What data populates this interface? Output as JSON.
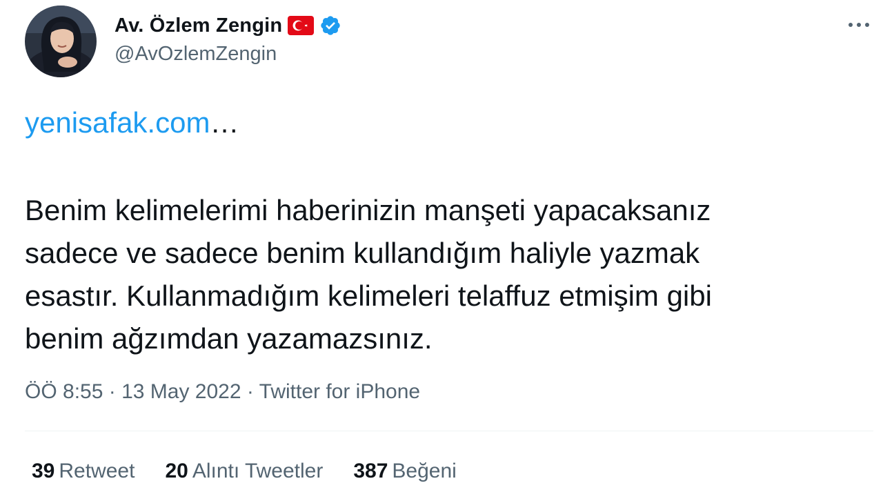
{
  "author": {
    "display_name": "Av. Özlem Zengin",
    "handle": "@AvOzlemZengin",
    "badges": [
      "turkey-flag-icon",
      "verified-icon"
    ],
    "verified_color": "#1d9bf0",
    "flag_color": "#e30a17"
  },
  "tweet": {
    "link_text": "yenisafak.com",
    "link_ellipsis": "…",
    "body_lines": [
      "Benim kelimelerimi haberinizin manşeti yapacaksanız",
      "sadece ve sadece benim kullandığım haliyle yazmak",
      "esastır. Kullanmadığım kelimeleri telaffuz etmişim gibi",
      "benim ağzımdan yazamazsınız."
    ]
  },
  "meta": {
    "time": "ÖÖ 8:55",
    "separator": " · ",
    "date": "13 May 2022",
    "source": "Twitter for iPhone"
  },
  "stats": [
    {
      "count": "39",
      "label": "Retweet"
    },
    {
      "count": "20",
      "label": "Alıntı Tweetler"
    },
    {
      "count": "387",
      "label": "Beğeni"
    }
  ],
  "colors": {
    "text": "#0f1419",
    "secondary": "#536471",
    "link": "#1d9bf0",
    "divider": "#eff3f4"
  },
  "icons": {
    "more": "more-horizontal-icon"
  }
}
